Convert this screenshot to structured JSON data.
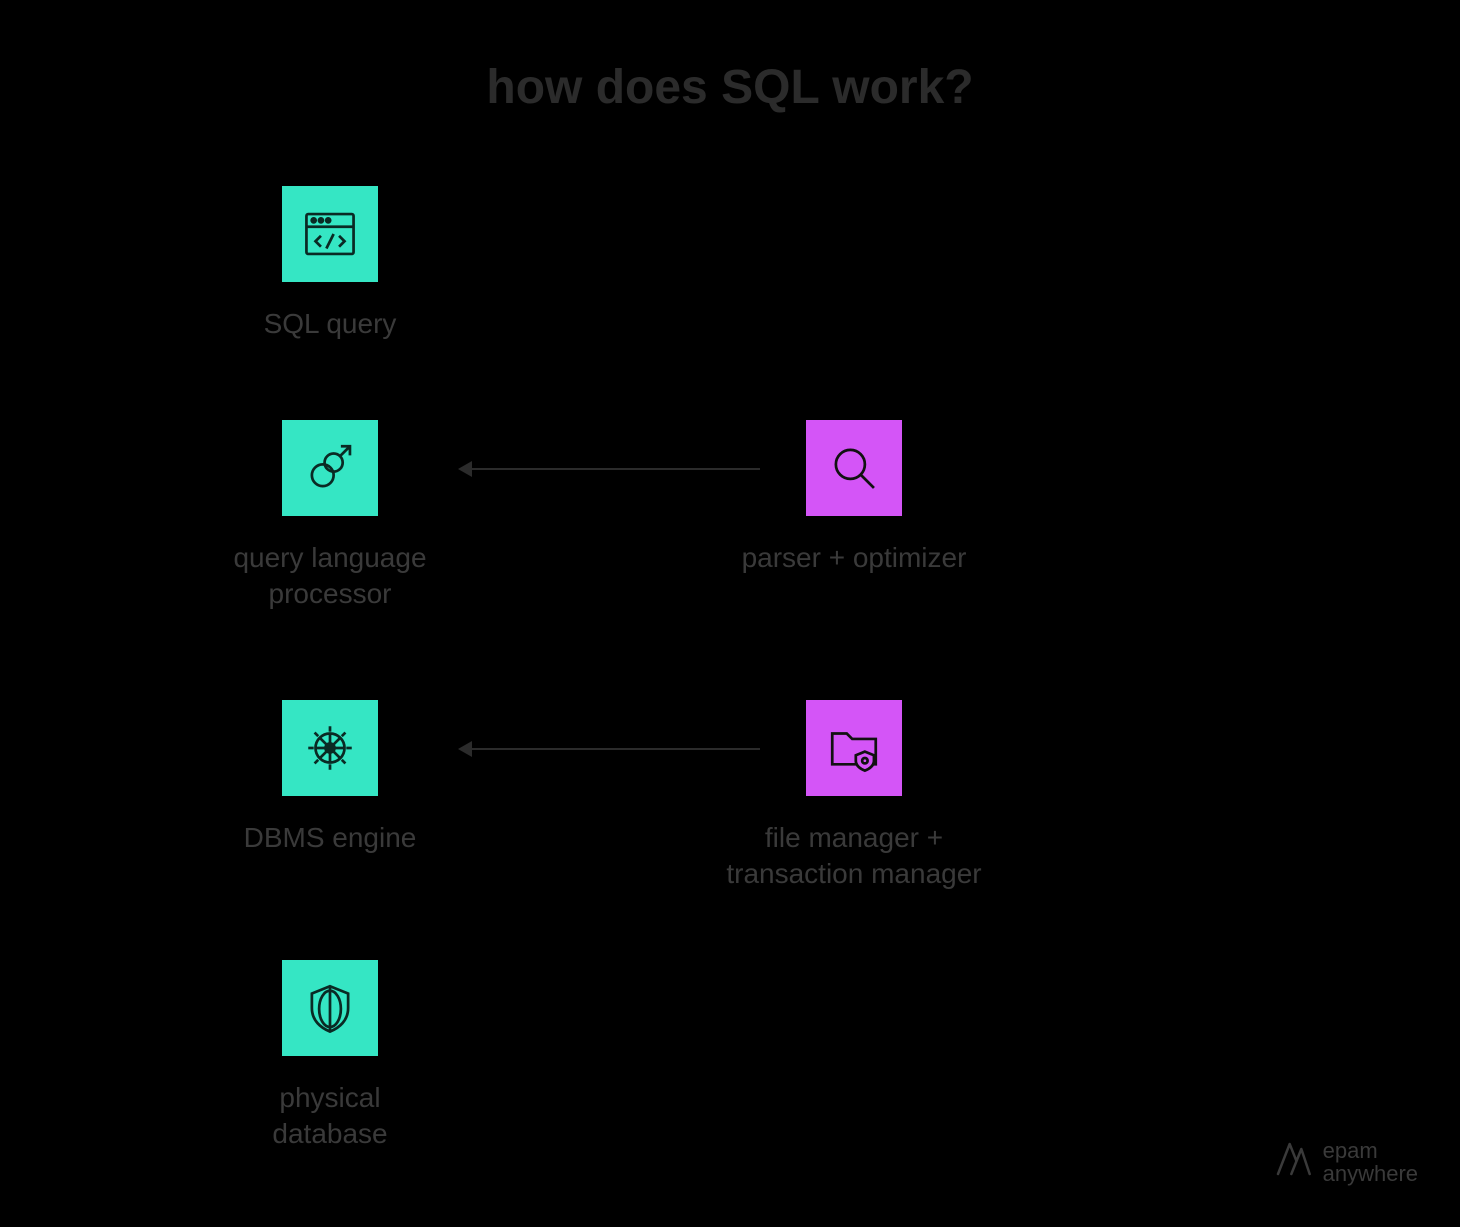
{
  "title": "how does SQL work?",
  "nodes": {
    "sql_query": {
      "label": "SQL query"
    },
    "qlp": {
      "label": "query language\nprocessor"
    },
    "dbms": {
      "label": "DBMS engine"
    },
    "physical": {
      "label": "physical\ndatabase"
    },
    "parser": {
      "label": "parser + optimizer"
    },
    "filemgr": {
      "label": "file manager +\ntransaction manager"
    }
  },
  "brand": {
    "line1": "epam",
    "line2": "anywhere"
  },
  "colors": {
    "teal": "#35e6c4",
    "magenta": "#d455f7"
  }
}
